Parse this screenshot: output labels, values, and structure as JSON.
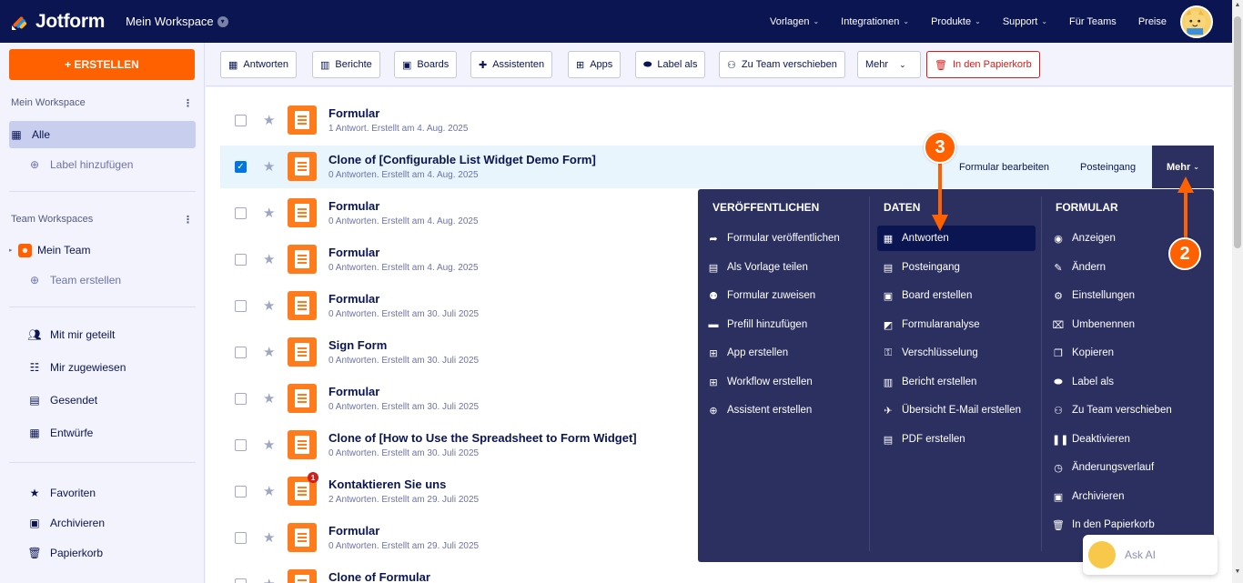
{
  "app": {
    "brand": "Jotform",
    "workspace": "Mein Workspace"
  },
  "nav": {
    "items": [
      {
        "label": "Vorlagen"
      },
      {
        "label": "Integrationen"
      },
      {
        "label": "Produkte"
      },
      {
        "label": "Support"
      },
      {
        "label": "Für Teams"
      },
      {
        "label": "Preise"
      }
    ]
  },
  "sidebar": {
    "create_label": "+ ERSTELLEN",
    "my_workspace_title": "Mein Workspace",
    "all_label": "Alle",
    "add_label": "Label hinzufügen",
    "team_workspaces_title": "Team Workspaces",
    "my_team": "Mein Team",
    "create_team": "Team erstellen",
    "shared": "Mit mir geteilt",
    "assigned": "Mir zugewiesen",
    "sent": "Gesendet",
    "drafts": "Entwürfe",
    "favorites": "Favoriten",
    "archive": "Archivieren",
    "trash": "Papierkorb"
  },
  "toolbar": {
    "antworten": "Antworten",
    "berichte": "Berichte",
    "boards": "Boards",
    "assistenten": "Assistenten",
    "apps": "Apps",
    "label_als": "Label als",
    "zu_team": "Zu Team verschieben",
    "mehr": "Mehr",
    "papierkorb": "In den Papierkorb"
  },
  "forms": [
    {
      "title": "Formular",
      "meta": "1 Antwort. Erstellt am 4. Aug. 2025"
    },
    {
      "title": "Clone of [Configurable List Widget Demo Form]",
      "meta": "0 Antworten. Erstellt am 4. Aug. 2025"
    },
    {
      "title": "Formular",
      "meta": "0 Antworten. Erstellt am 4. Aug. 2025"
    },
    {
      "title": "Formular",
      "meta": "0 Antworten. Erstellt am 4. Aug. 2025"
    },
    {
      "title": "Formular",
      "meta": "0 Antworten. Erstellt am 30. Juli 2025"
    },
    {
      "title": "Sign Form",
      "meta": "0 Antworten. Erstellt am 30. Juli 2025"
    },
    {
      "title": "Formular",
      "meta": "0 Antworten. Erstellt am 30. Juli 2025"
    },
    {
      "title": "Clone of [How to Use the Spreadsheet to Form Widget]",
      "meta": "0 Antworten. Erstellt am 30. Juli 2025"
    },
    {
      "title": "Kontaktieren Sie uns",
      "meta": "2 Antworten. Erstellt am 29. Juli 2025",
      "badge": "1"
    },
    {
      "title": "Formular",
      "meta": "0 Antworten. Erstellt am 29. Juli 2025"
    },
    {
      "title": "Clone of Formular",
      "meta": ""
    }
  ],
  "row_actions": {
    "edit": "Formular bearbeiten",
    "inbox": "Posteingang",
    "more": "Mehr"
  },
  "menu": {
    "publish_head": "VERÖFFENTLICHEN",
    "data_head": "DATEN",
    "form_head": "FORMULAR",
    "publish": [
      {
        "label": "Formular veröffentlichen",
        "icon": "share-icon"
      },
      {
        "label": "Als Vorlage teilen",
        "icon": "template-icon"
      },
      {
        "label": "Formular zuweisen",
        "icon": "assign-icon"
      },
      {
        "label": "Prefill hinzufügen",
        "icon": "prefill-icon"
      },
      {
        "label": "App erstellen",
        "icon": "app-icon"
      },
      {
        "label": "Workflow erstellen",
        "icon": "workflow-icon"
      },
      {
        "label": "Assistent erstellen",
        "icon": "assistant-icon"
      }
    ],
    "data": [
      {
        "label": "Antworten",
        "icon": "table-icon"
      },
      {
        "label": "Posteingang",
        "icon": "inbox-icon"
      },
      {
        "label": "Board erstellen",
        "icon": "board-icon"
      },
      {
        "label": "Formularanalyse",
        "icon": "analytics-icon"
      },
      {
        "label": "Verschlüsselung",
        "icon": "key-icon"
      },
      {
        "label": "Bericht erstellen",
        "icon": "report-icon"
      },
      {
        "label": "Übersicht E-Mail erstellen",
        "icon": "email-icon"
      },
      {
        "label": "PDF erstellen",
        "icon": "pdf-icon"
      }
    ],
    "form": [
      {
        "label": "Anzeigen",
        "icon": "eye-icon"
      },
      {
        "label": "Ändern",
        "icon": "edit-icon"
      },
      {
        "label": "Einstellungen",
        "icon": "gear-icon"
      },
      {
        "label": "Umbenennen",
        "icon": "rename-icon"
      },
      {
        "label": "Kopieren",
        "icon": "copy-icon"
      },
      {
        "label": "Label als",
        "icon": "label-icon"
      },
      {
        "label": "Zu Team verschieben",
        "icon": "team-icon"
      },
      {
        "label": "Deaktivieren",
        "icon": "pause-icon"
      },
      {
        "label": "Änderungsverlauf",
        "icon": "history-icon"
      },
      {
        "label": "Archivieren",
        "icon": "archive-icon"
      },
      {
        "label": "In den Papierkorb",
        "icon": "trash-icon"
      }
    ]
  },
  "annotations": {
    "step2": "2",
    "step3": "3"
  },
  "ask_ai": "Ask AI",
  "colors": {
    "navy": "#0a1551",
    "orange": "#ff6100",
    "menu_bg": "#2b3061",
    "danger": "#d01f1b",
    "selected_row": "#e9f5fd"
  }
}
